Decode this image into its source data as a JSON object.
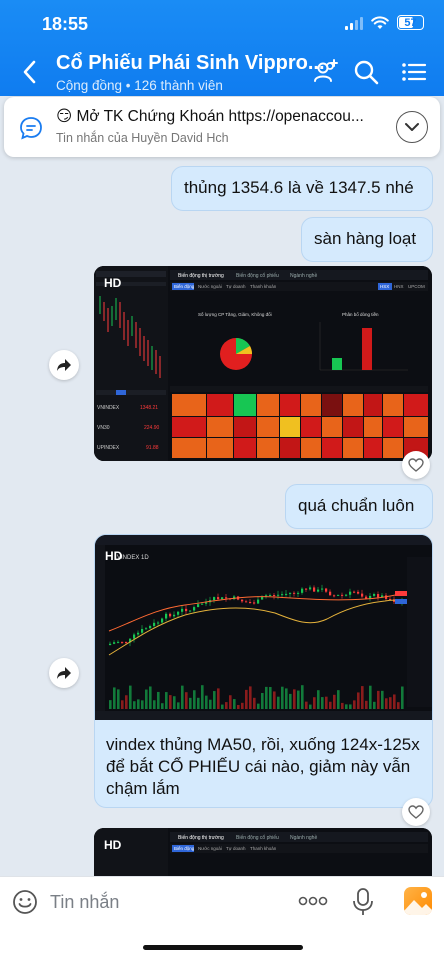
{
  "status": {
    "time": "18:55",
    "battery": "57"
  },
  "header": {
    "title": "Cổ Phiếu Phái Sinh Vippro...",
    "subtitle": "Cộng đồng • 126 thành viên"
  },
  "pinned": {
    "text": "😏 Mở TK Chứng Khoán https://openaccou...",
    "sender": "Tin nhắn của Huyền David Hch"
  },
  "messages": [
    {
      "text": "thủng 1354.6 là về 1347.5 nhé"
    },
    {
      "text": "sàn hàng loạt"
    },
    {
      "badge": "HD",
      "screenshot": {
        "tabs": [
          "Biến động thị trường",
          "Biến động cổ phiếu",
          "Ngành nghề"
        ],
        "subtabs": [
          "Biến động",
          "Nước ngoài",
          "Tự doanh",
          "Thanh khoản"
        ],
        "chart_titles": [
          "Số lượng CP Tăng, Giảm, Không đổi",
          "Phân bổ dòng tiền"
        ],
        "index_rows": [
          {
            "name": "VNINDEX",
            "value": "1348.21"
          },
          {
            "name": "VN30",
            "value": "224.90"
          },
          {
            "name": "UPINDEX",
            "value": "91.88"
          }
        ],
        "exchanges": [
          "HSX",
          "HNX",
          "UPCOM"
        ]
      }
    },
    {
      "text": "quá chuẩn luôn"
    },
    {
      "badge": "HD",
      "screenshot": {
        "symbol": "VINDEX 1D"
      }
    },
    {
      "text": "vindex thủng MA50, rồi, xuống 124x-125x để bắt CỔ PHIẾU cái nào, giảm này vẫn chậm lắm"
    },
    {
      "badge": "HD",
      "screenshot": {
        "tabs": [
          "Biến động thị trường",
          "Biến động cổ phiếu",
          "Ngành nghề"
        ],
        "subtabs": [
          "Biến động",
          "Nước ngoài",
          "Tự doanh",
          "Thanh khoản"
        ]
      }
    }
  ],
  "composer": {
    "placeholder": "Tin nhắn"
  },
  "colors": {
    "accent": "#0f7cf0",
    "bubble": "#d5eafd",
    "up": "#17c653",
    "down": "#ff3b3b"
  }
}
